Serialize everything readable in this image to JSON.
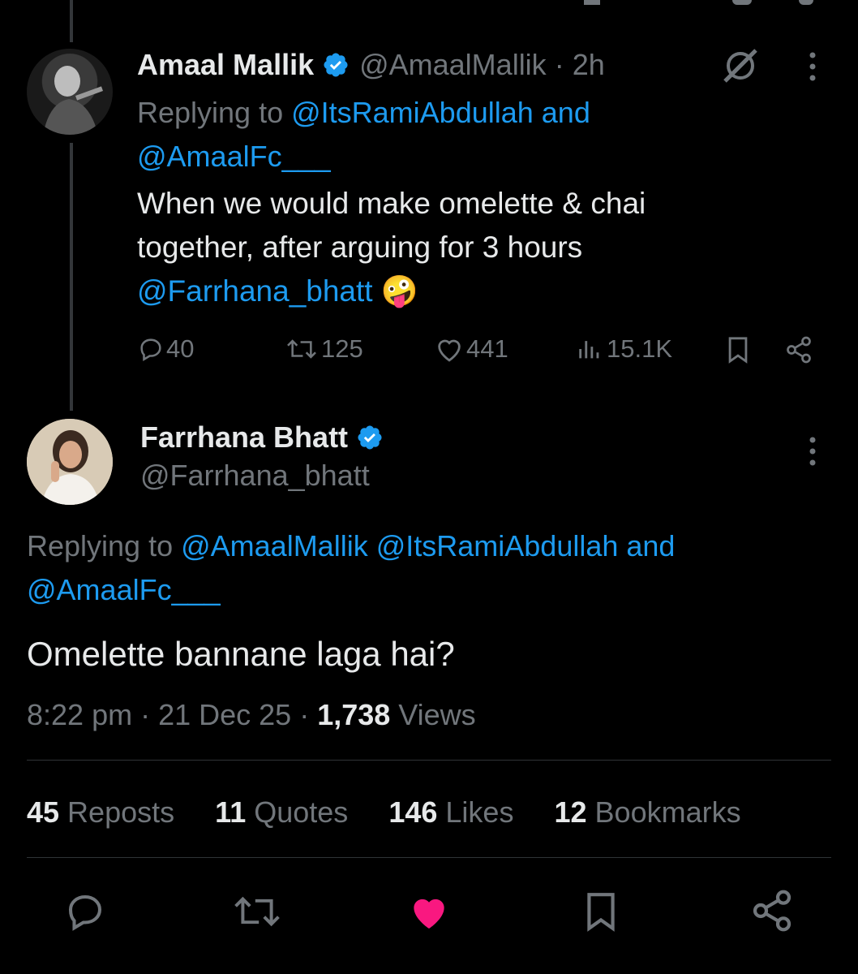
{
  "parent_tweet": {
    "name": "Amaal Mallik",
    "handle": "@AmaalMallik",
    "separator": " · ",
    "time": "2h",
    "replying_prefix": "Replying to ",
    "replying_to_1": "@ItsRamiAbdullah",
    "replying_and": " and",
    "replying_to_2": "@AmaalFc___",
    "text_line1": "When we would make omelette & chai",
    "text_line2": "together, after arguing for 3 hours",
    "mention": "@Farrhana_bhatt",
    "emoji": "🤪",
    "replies": "40",
    "reposts": "125",
    "likes": "441",
    "views": "15.1K"
  },
  "main_tweet": {
    "name": "Farrhana Bhatt",
    "handle": "@Farrhana_bhatt",
    "replying_prefix": "Replying to ",
    "replying_to_1": "@AmaalMallik",
    "replying_to_2": "@ItsRamiAbdullah",
    "replying_and": " and",
    "replying_to_3": "@AmaalFc___",
    "text": "Omelette bannane laga hai?",
    "time": "8:22 pm",
    "sep1": " · ",
    "date": "21 Dec 25",
    "sep2": " · ",
    "views_count": "1,738",
    "views_label": " Views"
  },
  "stats": {
    "reposts_count": "45",
    "reposts_label": " Reposts",
    "quotes_count": "11",
    "quotes_label": " Quotes",
    "likes_count": "146",
    "likes_label": " Likes",
    "bookmarks_count": "12",
    "bookmarks_label": " Bookmarks"
  },
  "colors": {
    "background": "#000000",
    "text": "#e7e9ea",
    "muted": "#71767b",
    "link": "#1d9bf0",
    "like_active": "#f91880",
    "verified": "#1d9bf0"
  },
  "icons": {
    "grok": "grok-icon",
    "more": "more-icon",
    "reply": "reply-icon",
    "repost": "repost-icon",
    "like": "heart-icon",
    "views": "views-icon",
    "bookmark": "bookmark-icon",
    "share": "share-icon"
  }
}
